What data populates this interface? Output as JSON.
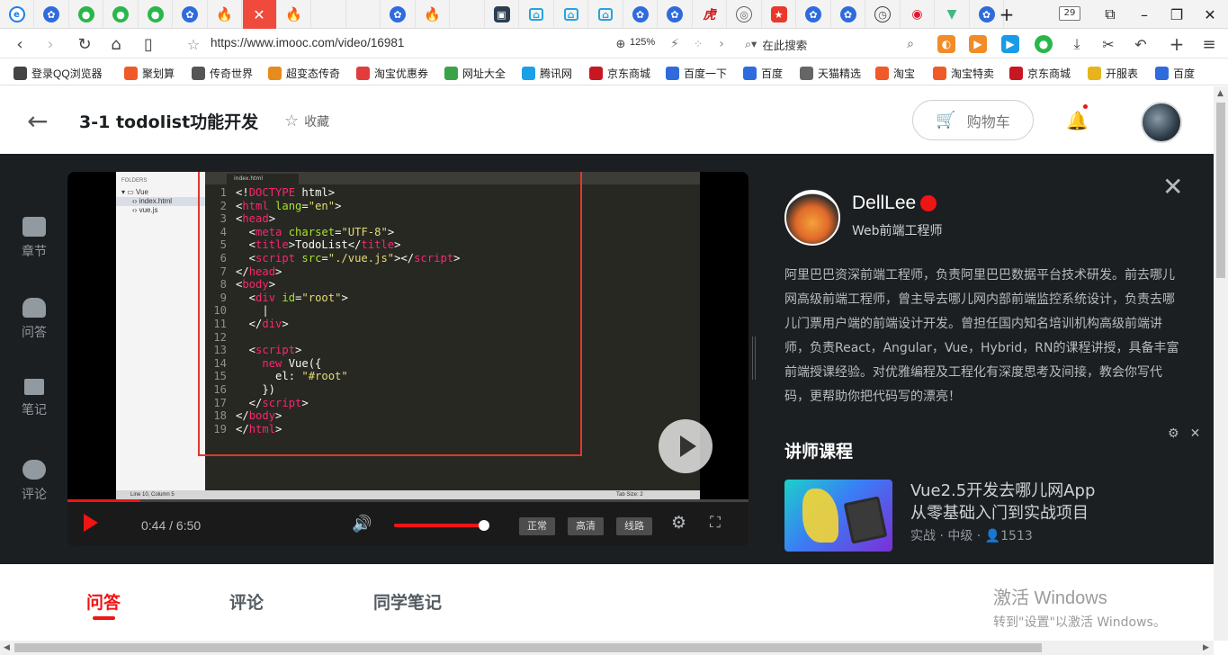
{
  "browser": {
    "tabs": [
      {
        "icon": "ie-icon",
        "glyph": "e"
      },
      {
        "icon": "baidu-paw-icon",
        "glyph": "✿"
      },
      {
        "icon": "wechat-icon",
        "glyph": "●"
      },
      {
        "icon": "wechat-icon",
        "glyph": "●"
      },
      {
        "icon": "wechat-icon",
        "glyph": "●"
      },
      {
        "icon": "baidu-paw-icon",
        "glyph": "✿"
      },
      {
        "icon": "fire-icon",
        "glyph": "🔥"
      },
      {
        "icon": "close-icon",
        "glyph": "✕",
        "active": true
      },
      {
        "icon": "fire-icon",
        "glyph": "🔥"
      },
      {
        "icon": "code-icon",
        "glyph": "⟲"
      },
      {
        "icon": "code-icon",
        "glyph": "⟲"
      },
      {
        "icon": "baidu-paw-icon",
        "glyph": "✿"
      },
      {
        "icon": "fire-icon",
        "glyph": "🔥"
      },
      {
        "icon": "translate-icon",
        "glyph": "あ"
      },
      {
        "icon": "app-icon",
        "glyph": "▣"
      },
      {
        "icon": "bilibili-icon",
        "glyph": "⌂"
      },
      {
        "icon": "bilibili-icon",
        "glyph": "⌂"
      },
      {
        "icon": "bilibili-icon",
        "glyph": "⌂"
      },
      {
        "icon": "baidu-paw-icon",
        "glyph": "✿"
      },
      {
        "icon": "baidu-paw-icon",
        "glyph": "✿"
      },
      {
        "icon": "tiger-icon",
        "glyph": "虎"
      },
      {
        "icon": "globe-icon",
        "glyph": "◎"
      },
      {
        "icon": "app-icon",
        "glyph": "★"
      },
      {
        "icon": "baidu-paw-icon",
        "glyph": "✿"
      },
      {
        "icon": "baidu-paw-icon",
        "glyph": "✿"
      },
      {
        "icon": "clock-icon",
        "glyph": "◷"
      },
      {
        "icon": "weibo-icon",
        "glyph": "◉"
      },
      {
        "icon": "vue-icon",
        "glyph": "▼"
      },
      {
        "icon": "baidu-paw-icon",
        "glyph": "✿"
      }
    ],
    "tab_count": "29",
    "url": "https://www.imooc.com/video/16981",
    "zoom": "125%",
    "search_placeholder": "在此搜索",
    "bookmarks": [
      {
        "label": "登录QQ浏览器",
        "color": "#444"
      },
      {
        "label": "聚划算",
        "color": "#f05a28"
      },
      {
        "label": "传奇世界",
        "color": "#555"
      },
      {
        "label": "超变态传奇",
        "color": "#e88b1d"
      },
      {
        "label": "淘宝优惠券",
        "color": "#e33c3c"
      },
      {
        "label": "网址大全",
        "color": "#3aa348"
      },
      {
        "label": "腾讯网",
        "color": "#1aa0e8"
      },
      {
        "label": "京东商城",
        "color": "#c81623"
      },
      {
        "label": "百度一下",
        "color": "#2f6bdc"
      },
      {
        "label": "百度",
        "color": "#2f6bdc"
      },
      {
        "label": "天猫精选",
        "color": "#666"
      },
      {
        "label": "淘宝",
        "color": "#f05a28"
      },
      {
        "label": "淘宝特卖",
        "color": "#f05a28"
      },
      {
        "label": "京东商城",
        "color": "#c81623"
      },
      {
        "label": "开服表",
        "color": "#e8b41d"
      },
      {
        "label": "百度",
        "color": "#2f6bdc"
      }
    ]
  },
  "header": {
    "title": "3-1 todolist功能开发",
    "favorite_label": "收藏",
    "cart_label": "购物车"
  },
  "side_nav": [
    {
      "label": "章节",
      "icon": "chapter-icon"
    },
    {
      "label": "问答",
      "icon": "qa-icon"
    },
    {
      "label": "笔记",
      "icon": "note-icon"
    },
    {
      "label": "评论",
      "icon": "comment-icon"
    }
  ],
  "editor": {
    "folders_label": "FOLDERS",
    "folder": "Vue",
    "files": [
      "index.html",
      "vue.js"
    ],
    "tab_name": "index.html",
    "status": "Line 10, Column 5",
    "tab_size": "Tab Size: 2",
    "lines": [
      {
        "n": "1",
        "html": "&lt;!<span class='t'>DOCTYPE</span> html&gt;"
      },
      {
        "n": "2",
        "html": "&lt;<span class='t'>html</span> <span class='a'>lang</span>=<span class='s'>\"en\"</span>&gt;"
      },
      {
        "n": "3",
        "html": "&lt;<span class='t'>head</span>&gt;"
      },
      {
        "n": "4",
        "html": "  &lt;<span class='t'>meta</span> <span class='a'>charset</span>=<span class='s'>\"UTF-8\"</span>&gt;"
      },
      {
        "n": "5",
        "html": "  &lt;<span class='t'>title</span>&gt;TodoList&lt;/<span class='t'>title</span>&gt;"
      },
      {
        "n": "6",
        "html": "  &lt;<span class='t'>script</span> <span class='a'>src</span>=<span class='s'>\"./vue.js\"</span>&gt;&lt;/<span class='t'>script</span>&gt;"
      },
      {
        "n": "7",
        "html": "&lt;/<span class='t'>head</span>&gt;"
      },
      {
        "n": "8",
        "html": "&lt;<span class='t'>body</span>&gt;"
      },
      {
        "n": "9",
        "html": "  &lt;<span class='t'>div</span> <span class='a'>id</span>=<span class='s'>\"root\"</span>&gt;"
      },
      {
        "n": "10",
        "html": "    |"
      },
      {
        "n": "11",
        "html": "  &lt;/<span class='t'>div</span>&gt;"
      },
      {
        "n": "12",
        "html": ""
      },
      {
        "n": "13",
        "html": "  &lt;<span class='t'>script</span>&gt;"
      },
      {
        "n": "14",
        "html": "    <span class='t'>new</span> Vue({"
      },
      {
        "n": "15",
        "html": "      el: <span class='s'>\"#root\"</span>"
      },
      {
        "n": "16",
        "html": "    })"
      },
      {
        "n": "17",
        "html": "  &lt;/<span class='t'>script</span>&gt;"
      },
      {
        "n": "18",
        "html": "&lt;/<span class='t'>body</span>&gt;"
      },
      {
        "n": "19",
        "html": "&lt;/<span class='t'>html</span>&gt;"
      }
    ]
  },
  "player": {
    "current_time": "0:44",
    "separator": "/",
    "duration": "6:50",
    "progress_fraction": 0.107,
    "volume_fraction": 1.0,
    "quality_buttons": [
      "正常",
      "高清",
      "线路"
    ]
  },
  "teacher": {
    "name": "DellLee",
    "role": "Web前端工程师",
    "bio": "阿里巴巴资深前端工程师，负责阿里巴巴数据平台技术研发。前去哪儿网高级前端工程师，曾主导去哪儿网内部前端监控系统设计，负责去哪儿门票用户端的前端设计开发。曾担任国内知名培训机构高级前端讲师，负责React，Angular，Vue，Hybrid，RN的课程讲授，具备丰富前端授课经验。对优雅编程及工程化有深度思考及间接，教会你写代码，更帮助你把代码写的漂亮！",
    "courses_title": "讲师课程",
    "course": {
      "title_line1": "Vue2.5开发去哪儿网App",
      "title_line2": "从零基础入门到实战项目",
      "meta": "实战 · 中级 · 👤1513"
    }
  },
  "bottom_tabs": [
    {
      "label": "问答",
      "active": true
    },
    {
      "label": "评论",
      "active": false
    },
    {
      "label": "同学笔记",
      "active": false
    }
  ],
  "watermark": {
    "line1": "激活 Windows",
    "line2": "转到\"设置\"以激活 Windows。"
  },
  "colors": {
    "accent": "#f01414",
    "dark_bg": "#1c1f21"
  }
}
